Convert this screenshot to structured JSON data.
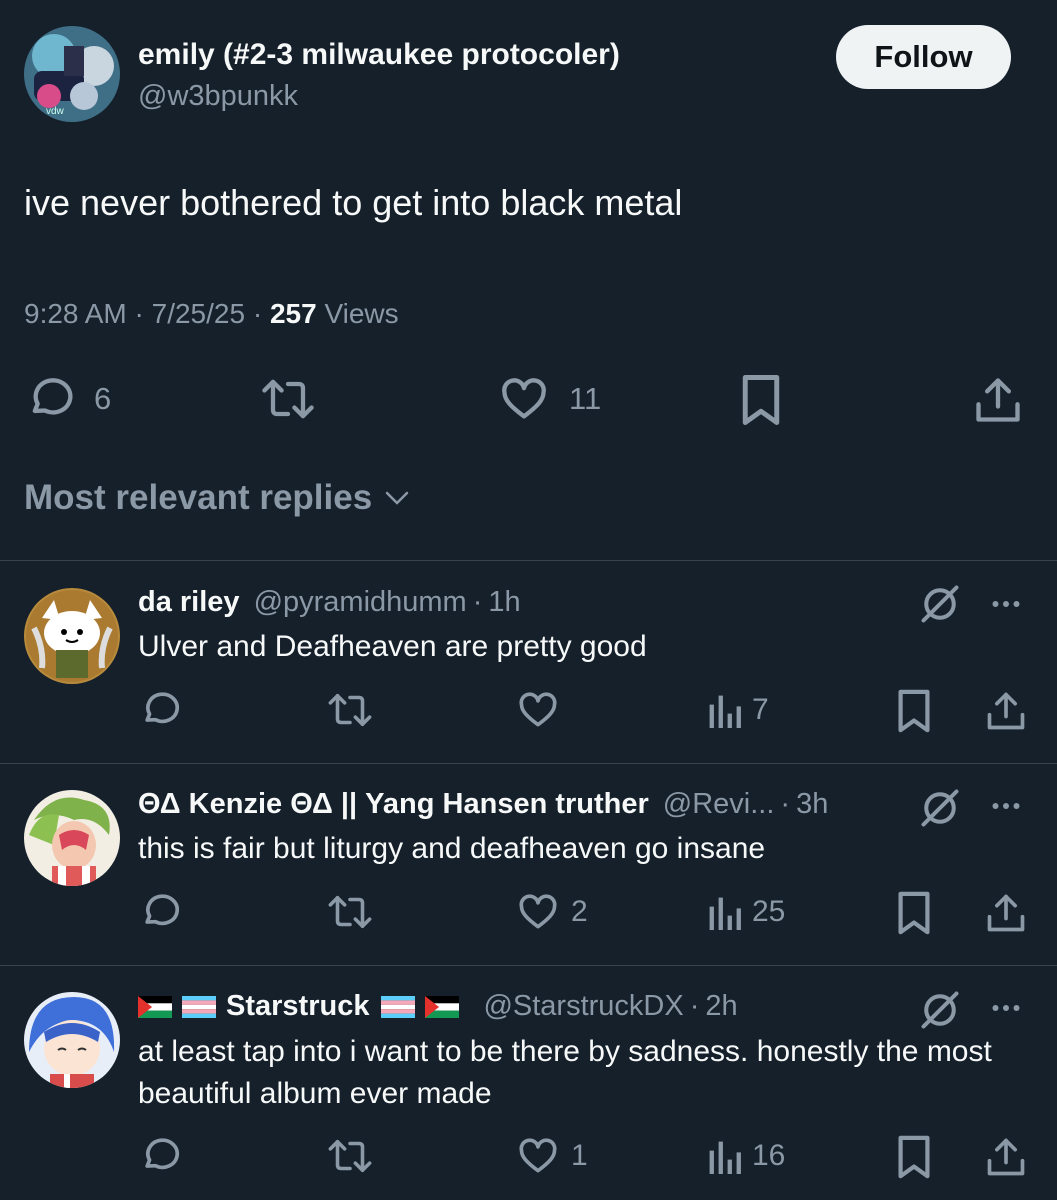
{
  "tweet": {
    "author_name": "emily (#2-3 milwaukee protocoler)",
    "author_handle": "@w3bpunkk",
    "follow_label": "Follow",
    "text": "ive never bothered to get into black metal",
    "time": "9:28 AM",
    "date": "7/25/25",
    "views_count": "257",
    "views_label": "Views",
    "replies": "6",
    "likes": "11"
  },
  "replies_header": "Most relevant replies",
  "replies": [
    {
      "name": "da riley",
      "handle": "@pyramidhumm",
      "time": "1h",
      "text": "Ulver and Deafheaven are pretty good",
      "likes": "",
      "views": "7"
    },
    {
      "name": "ΘΔ Kenzie ΘΔ || Yang Hansen truther",
      "handle": "@Revi...",
      "time": "3h",
      "text": "this is fair but liturgy and deafheaven go insane",
      "likes": "2",
      "views": "25"
    },
    {
      "name": "Starstruck",
      "handle": "@StarstruckDX",
      "time": "2h",
      "text": "at least tap into i want to be there by sadness. honestly the most beautiful album ever made",
      "likes": "1",
      "views": "16"
    }
  ],
  "colors": {
    "background": "#15202b",
    "text": "#f7f9f9",
    "muted": "#8b98a5",
    "divider": "#38444d",
    "follow_bg": "#eff3f4"
  },
  "icons": [
    "reply-icon",
    "retweet-icon",
    "like-icon",
    "bookmark-icon",
    "share-icon",
    "views-icon",
    "grok-icon",
    "more-icon",
    "chevron-down-icon"
  ]
}
